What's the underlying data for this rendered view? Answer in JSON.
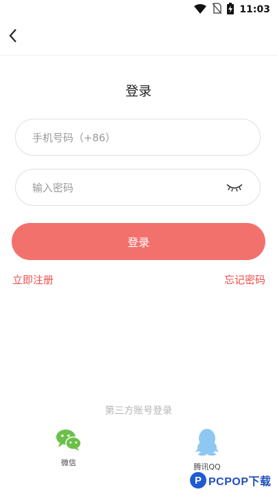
{
  "status_bar": {
    "time": "11:03",
    "icons": [
      "wifi-icon",
      "no-sim-icon",
      "battery-charging-icon"
    ]
  },
  "nav": {
    "back_icon": "chevron-left-icon"
  },
  "page_title": "登录",
  "form": {
    "phone_placeholder": "手机号码（+86）",
    "phone_value": "",
    "password_placeholder": "输入密码",
    "password_value": "",
    "eye_icon": "closed-eye-icon",
    "login_label": "登录"
  },
  "links": {
    "register": "立即注册",
    "forgot": "忘记密码"
  },
  "third_party": {
    "title": "第三方账号登录",
    "items": [
      {
        "label": "微信",
        "icon": "wechat-icon"
      },
      {
        "label": "腾讯QQ",
        "icon": "qq-icon"
      }
    ]
  },
  "watermark": {
    "text": "PCPOP下载"
  },
  "colors": {
    "primary": "#f3716c",
    "link": "#ef4e4a",
    "wechat": "#6cc04a",
    "qq": "#8ec8f2",
    "muted": "#b5b5b5"
  }
}
